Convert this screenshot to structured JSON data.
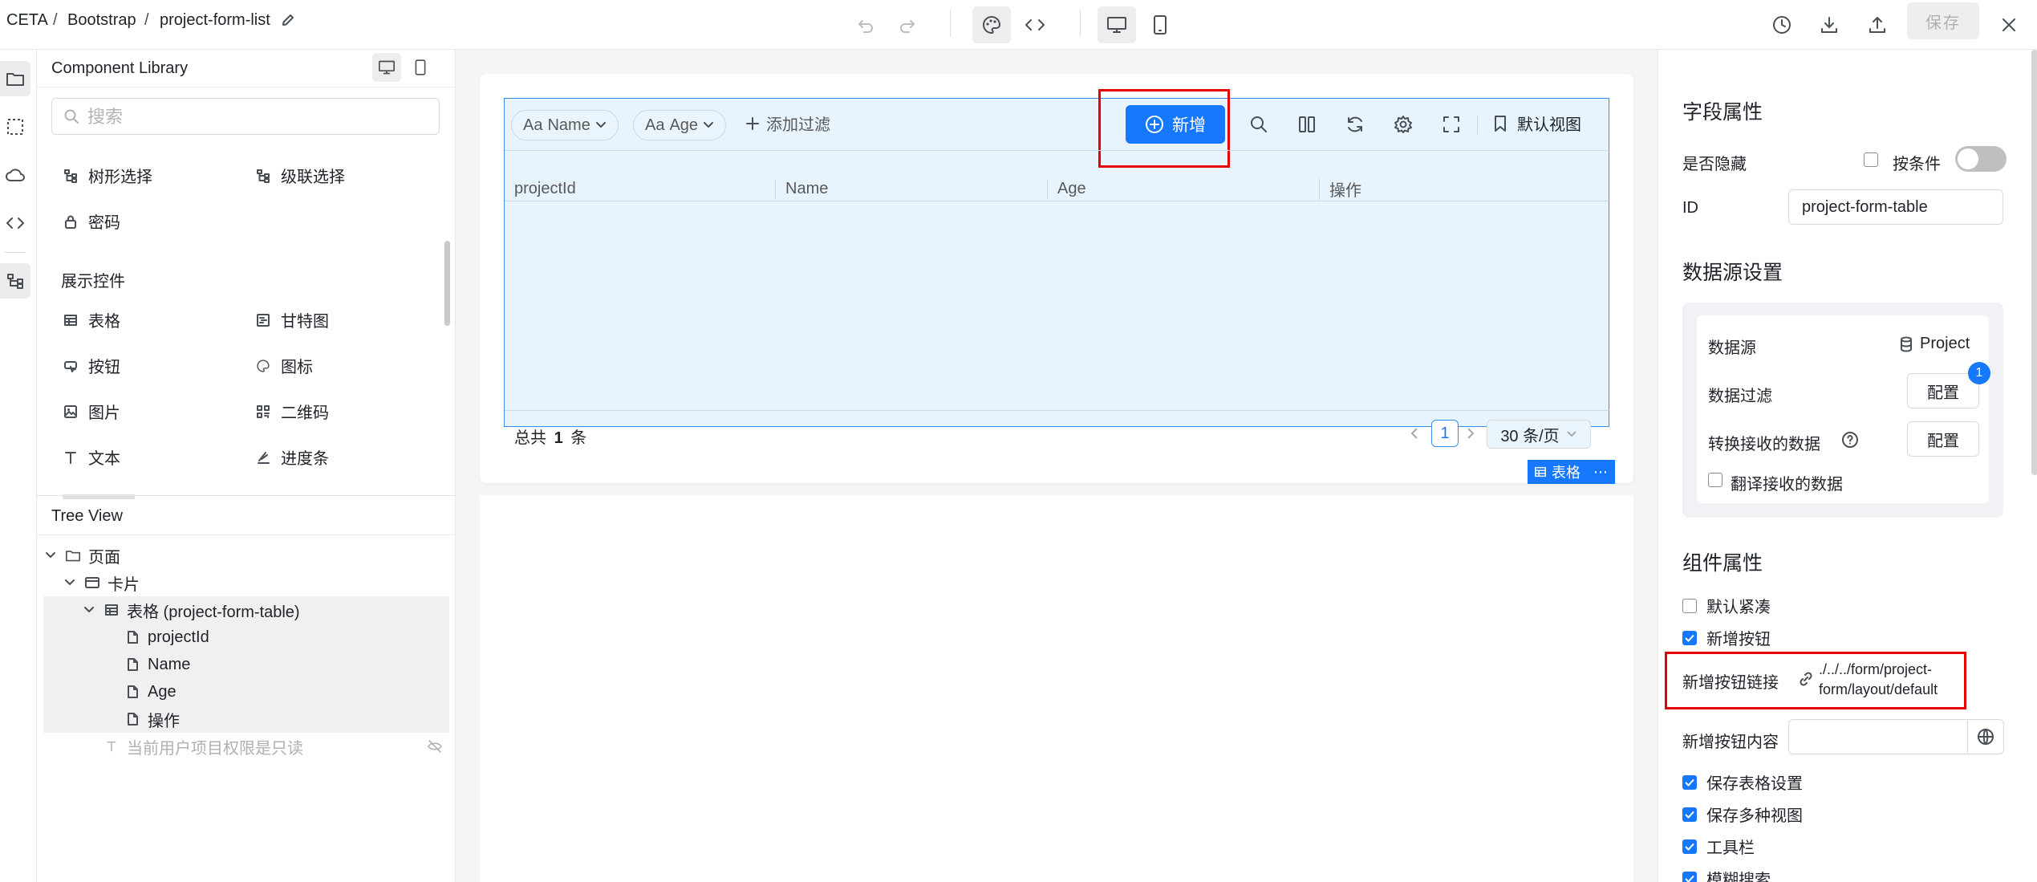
{
  "breadcrumb": {
    "items": [
      "CETA",
      "Bootstrap",
      "project-form-list"
    ],
    "sep": "/"
  },
  "toolbar": {
    "save_label": "保存"
  },
  "library": {
    "title": "Component Library",
    "search_placeholder": "搜索",
    "items_top": [
      {
        "label": "树形选择",
        "icon": "tree-select-icon"
      },
      {
        "label": "级联选择",
        "icon": "cascader-icon"
      },
      {
        "label": "密码",
        "icon": "lock-icon"
      }
    ],
    "section": "展示控件",
    "items_display": [
      {
        "label": "表格",
        "icon": "table-icon"
      },
      {
        "label": "甘特图",
        "icon": "gantt-icon"
      },
      {
        "label": "按钮",
        "icon": "button-icon"
      },
      {
        "label": "图标",
        "icon": "palette-icon"
      },
      {
        "label": "图片",
        "icon": "image-icon"
      },
      {
        "label": "二维码",
        "icon": "qrcode-icon"
      },
      {
        "label": "文本",
        "icon": "text-icon"
      },
      {
        "label": "进度条",
        "icon": "progress-icon"
      }
    ]
  },
  "tree": {
    "title": "Tree View",
    "nodes": [
      {
        "label": "页面",
        "icon": "folder-icon",
        "level": 0
      },
      {
        "label": "卡片",
        "icon": "card-icon",
        "level": 1
      },
      {
        "label": "表格 (project-form-table)",
        "icon": "table-icon",
        "level": 2
      },
      {
        "label": "projectId",
        "icon": "file-icon",
        "level": 3
      },
      {
        "label": "Name",
        "icon": "file-icon",
        "level": 3
      },
      {
        "label": "Age",
        "icon": "file-icon",
        "level": 3
      },
      {
        "label": "操作",
        "icon": "file-icon",
        "level": 3
      },
      {
        "label": "当前用户项目权限是只读",
        "icon": "text-icon",
        "level": 2
      }
    ]
  },
  "table": {
    "filters": [
      "Name",
      "Age"
    ],
    "filter_prefix": "Aa",
    "add_filter": "添加过滤",
    "add_button": "新增",
    "default_view": "默认视图",
    "columns": [
      "projectId",
      "Name",
      "Age",
      "操作"
    ],
    "total_prefix": "总共",
    "total_count": "1",
    "total_suffix": "条",
    "page": "1",
    "page_size": "30 条/页",
    "tag": "表格"
  },
  "props": {
    "field_title": "字段属性",
    "hidden_label": "是否隐藏",
    "condition_label": "按条件",
    "id_label": "ID",
    "id_value": "project-form-table",
    "ds_title": "数据源设置",
    "ds_label": "数据源",
    "ds_value": "Project",
    "filter_label": "数据过滤",
    "filter_badge": "1",
    "transform_label": "转换接收的数据",
    "config_label": "配置",
    "translate_label": "翻译接收的数据",
    "comp_title": "组件属性",
    "default_compact": "默认紧凑",
    "add_button_opt": "新增按钮",
    "add_link_label": "新增按钮链接",
    "add_link_value_1": "./../../form/project-",
    "add_link_value_2": "form/layout/default",
    "add_content_label": "新增按钮内容",
    "opt_save_table": "保存表格设置",
    "opt_save_views": "保存多种视图",
    "opt_toolbar": "工具栏",
    "opt_fuzzy": "模糊搜索"
  }
}
